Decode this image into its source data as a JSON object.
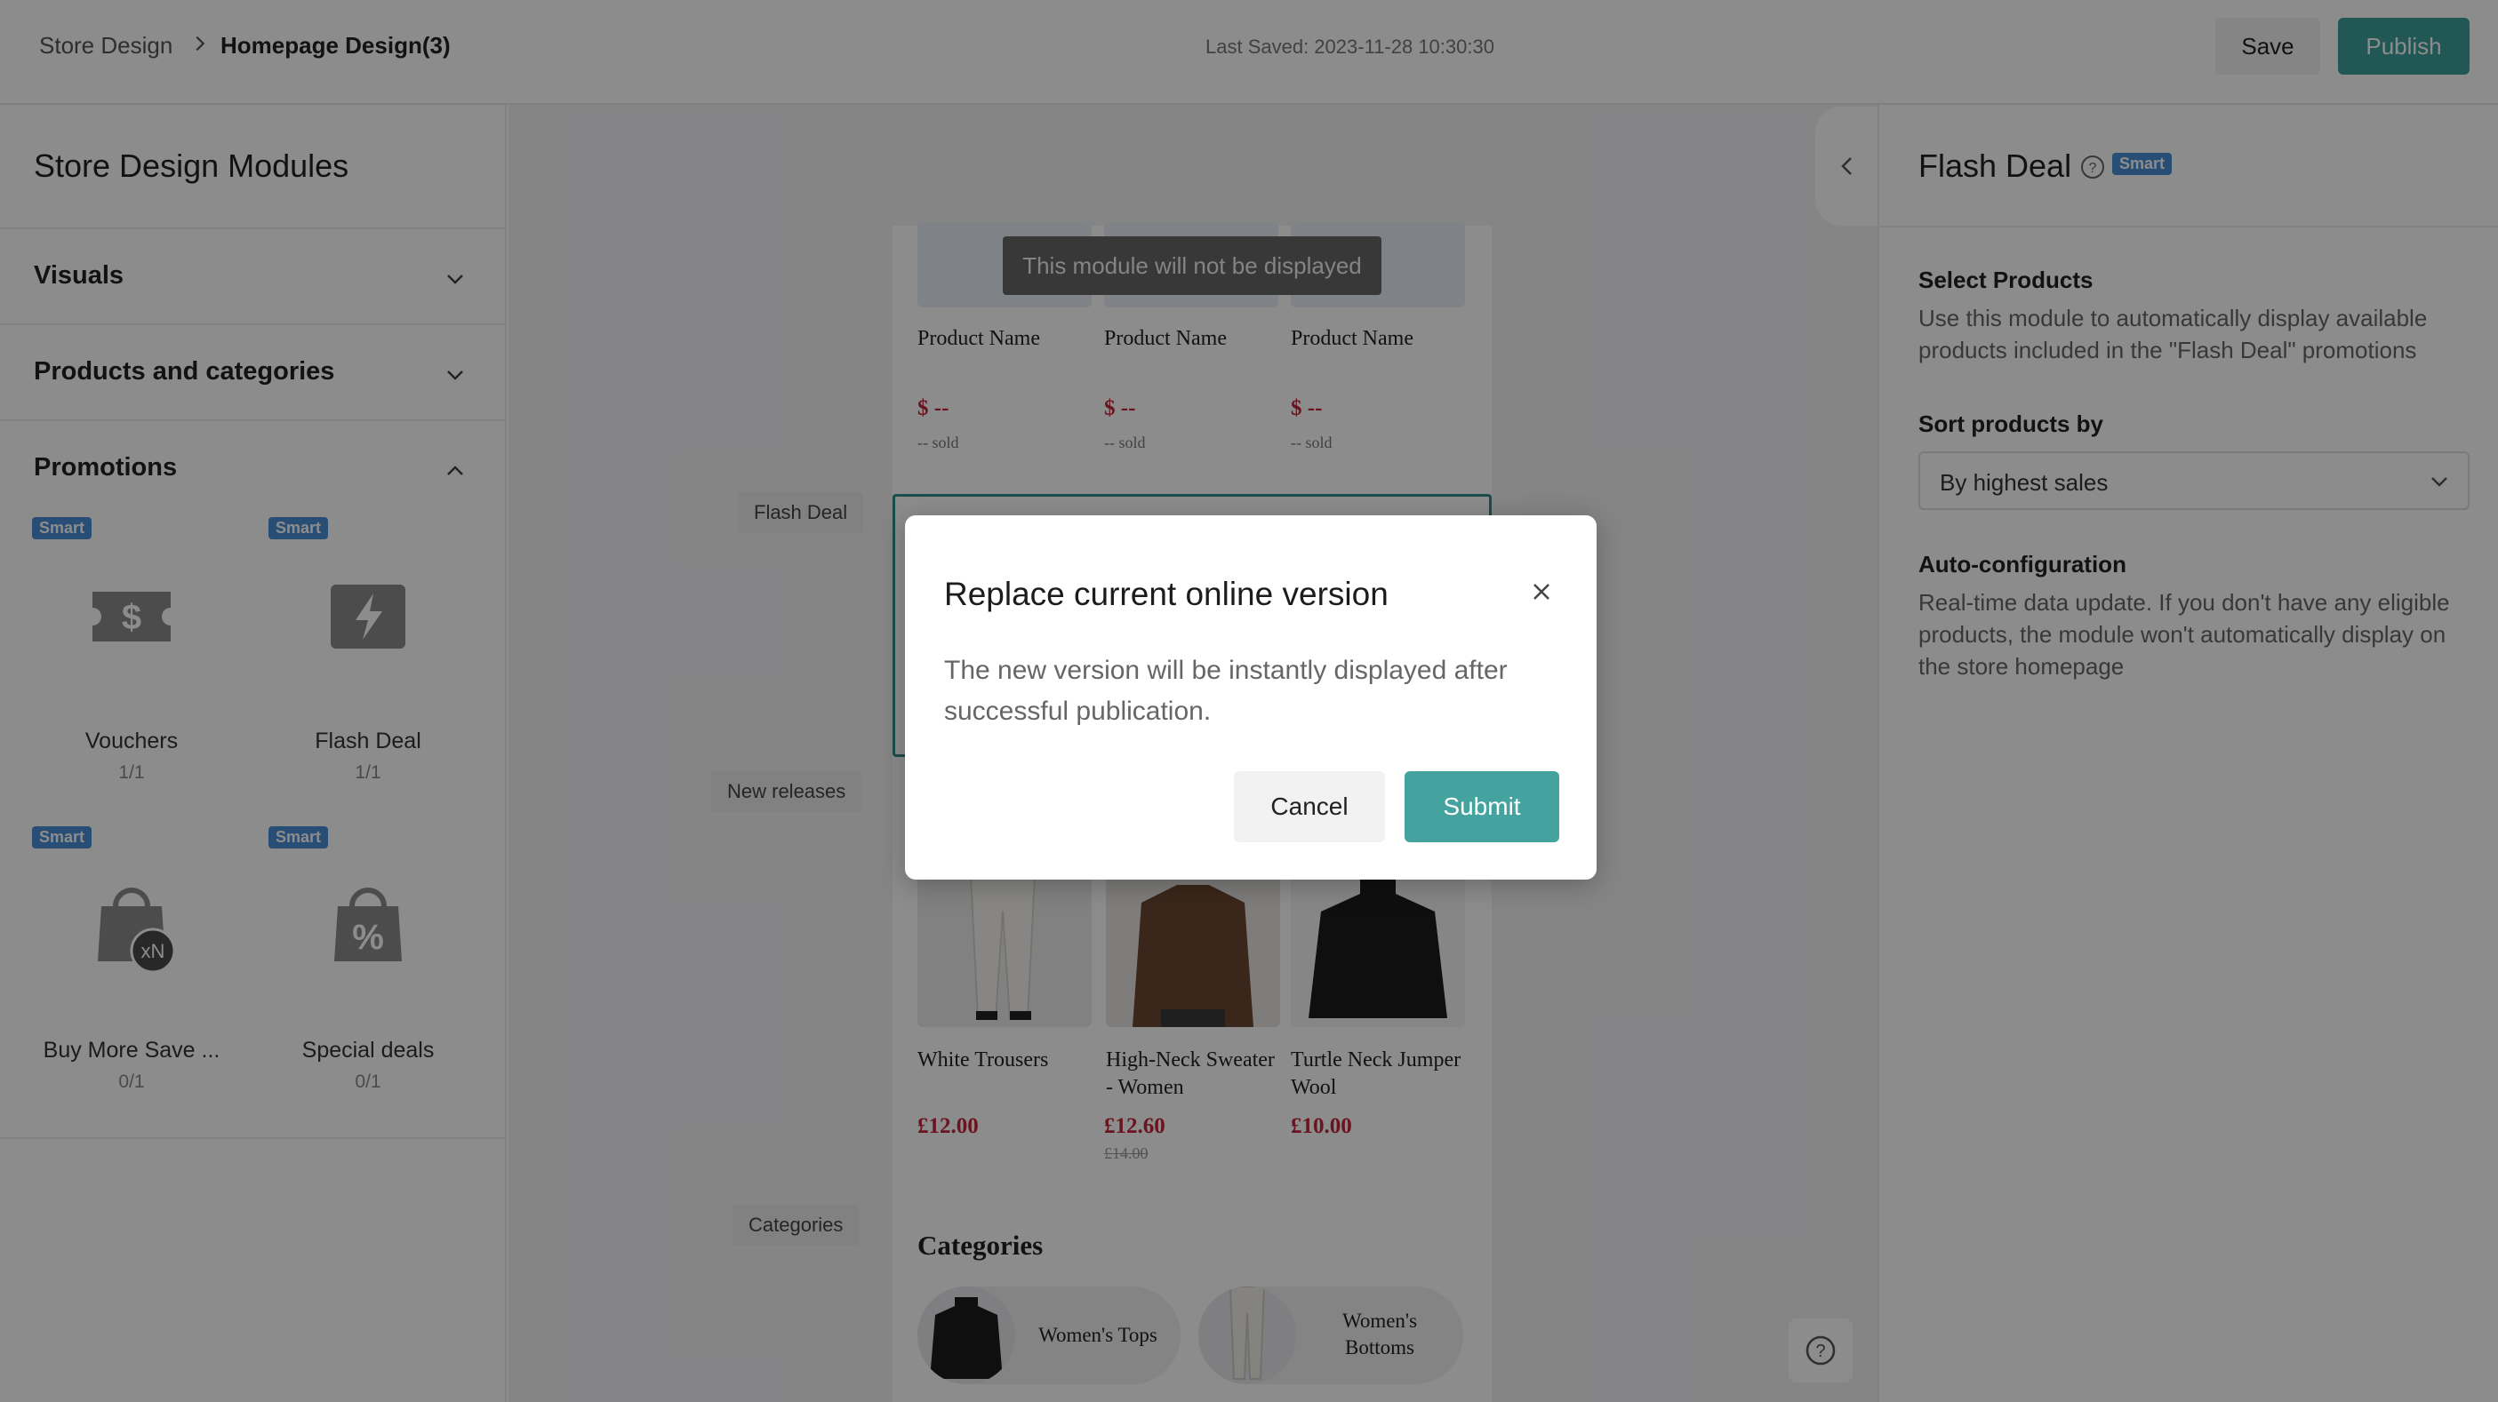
{
  "header": {
    "breadcrumb_root": "Store Design",
    "breadcrumb_current": "Homepage Design(3)",
    "last_saved": "Last Saved: 2023-11-28 10:30:30",
    "save_label": "Save",
    "publish_label": "Publish"
  },
  "sidebar": {
    "title": "Store Design Modules",
    "sections": [
      {
        "label": "Visuals",
        "icon": "chevron-down-icon"
      },
      {
        "label": "Products and categories",
        "icon": "chevron-down-icon"
      },
      {
        "label": "Promotions",
        "icon": "chevron-up-icon"
      }
    ],
    "modules": [
      {
        "name": "Vouchers",
        "count": "1/1",
        "badge": "Smart",
        "icon": "voucher-dollar-icon"
      },
      {
        "name": "Flash Deal",
        "count": "1/1",
        "badge": "Smart",
        "icon": "lightning-icon"
      },
      {
        "name": "Buy More Save ...",
        "count": "0/1",
        "badge": "Smart",
        "icon": "bag-xn-icon"
      },
      {
        "name": "Special deals",
        "count": "0/1",
        "badge": "Smart",
        "icon": "bag-percent-icon"
      }
    ]
  },
  "canvas": {
    "hidden_notice": "This module will not be displayed",
    "top_products": [
      {
        "name": "Product Name",
        "price": "$ --",
        "sold": "-- sold"
      },
      {
        "name": "Product Name",
        "price": "$ --",
        "sold": "-- sold"
      },
      {
        "name": "Product Name",
        "price": "$ --",
        "sold": "-- sold"
      }
    ],
    "module_labels": {
      "flash_deal": "Flash Deal",
      "new_releases": "New releases",
      "categories": "Categories"
    },
    "new_releases": [
      {
        "name": "White Trousers",
        "price": "£12.00",
        "old_price": ""
      },
      {
        "name": "High-Neck Sweater - Women",
        "price": "£12.60",
        "old_price": "£14.00"
      },
      {
        "name": "Turtle Neck Jumper Wool",
        "price": "£10.00",
        "old_price": ""
      }
    ],
    "categories_title": "Categories",
    "categories": [
      {
        "label": "Women's Tops"
      },
      {
        "label": "Women's Bottoms"
      }
    ]
  },
  "right_panel": {
    "title": "Flash Deal",
    "badge": "Smart",
    "select_products_heading": "Select Products",
    "select_products_text": "Use this module to automatically display available products included in the \"Flash Deal\" promotions",
    "sort_heading": "Sort products by",
    "sort_value": "By highest sales",
    "auto_config_heading": "Auto-configuration",
    "auto_config_text": "Real-time data update. If you don't have any eligible products, the module won't automatically display on the store homepage"
  },
  "modal": {
    "title": "Replace current online version",
    "body": "The new version will be instantly displayed after successful publication.",
    "cancel_label": "Cancel",
    "submit_label": "Submit"
  },
  "colors": {
    "accent": "#3d9e9c",
    "smart_badge": "#4a8fd8",
    "price_red": "#c0253a"
  }
}
